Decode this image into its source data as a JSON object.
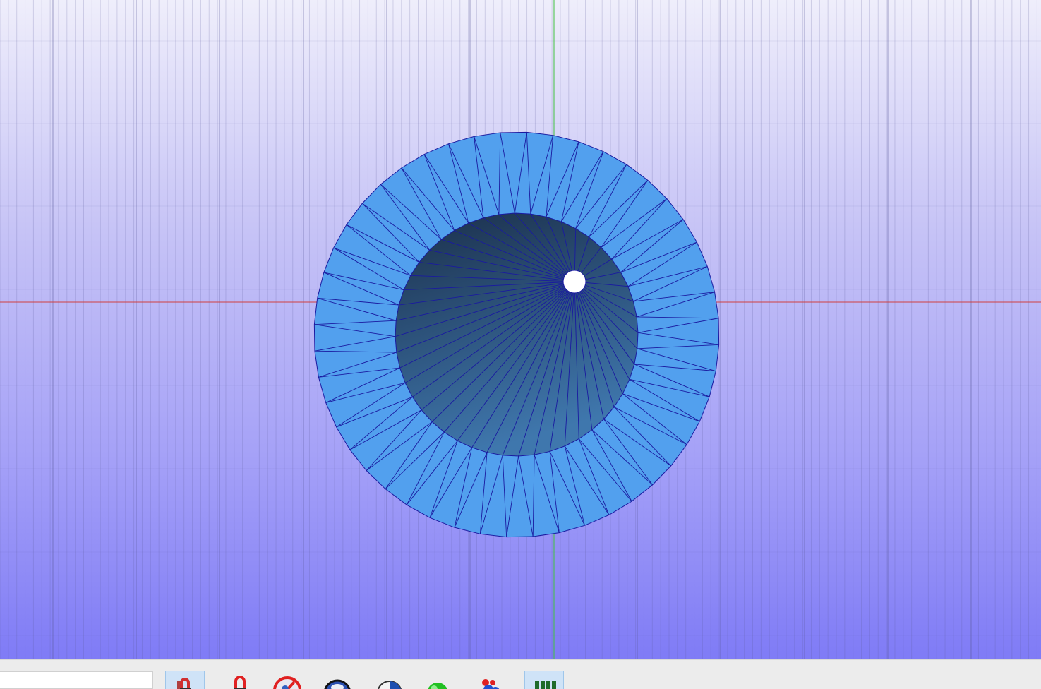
{
  "viewport": {
    "background_top": "#efeefb",
    "background_bottom": "#7f7bf6",
    "grid_color": "#5a5a9a",
    "x_axis_color": "#d04040",
    "y_axis_color": "#40c040",
    "mesh": {
      "outer_ring_color": "#52a0ee",
      "inner_cone_color_dark": "#1b2f4a",
      "inner_cone_color_light": "#3f77ad",
      "edge_color": "#1a1aa0",
      "segments": 48
    }
  },
  "toolbar": {
    "search": {
      "value": "",
      "placeholder": ""
    },
    "buttons": [
      {
        "name": "magnet-tool-button",
        "icon": "magnet-icon",
        "active": true
      },
      {
        "name": "snap-magnet-button",
        "icon": "red-magnet-icon",
        "active": false
      },
      {
        "name": "no-snap-button",
        "icon": "no-entry-icon",
        "active": false
      },
      {
        "name": "view-sphere-button",
        "icon": "globe-icon",
        "active": false
      },
      {
        "name": "half-sphere-button",
        "icon": "half-sphere-icon",
        "active": false
      },
      {
        "name": "green-sphere-button",
        "icon": "green-sphere-icon",
        "active": false
      },
      {
        "name": "particles-button",
        "icon": "particles-icon",
        "active": false
      },
      {
        "name": "grid-toggle-button",
        "icon": "grid-icon",
        "active": true
      }
    ]
  }
}
